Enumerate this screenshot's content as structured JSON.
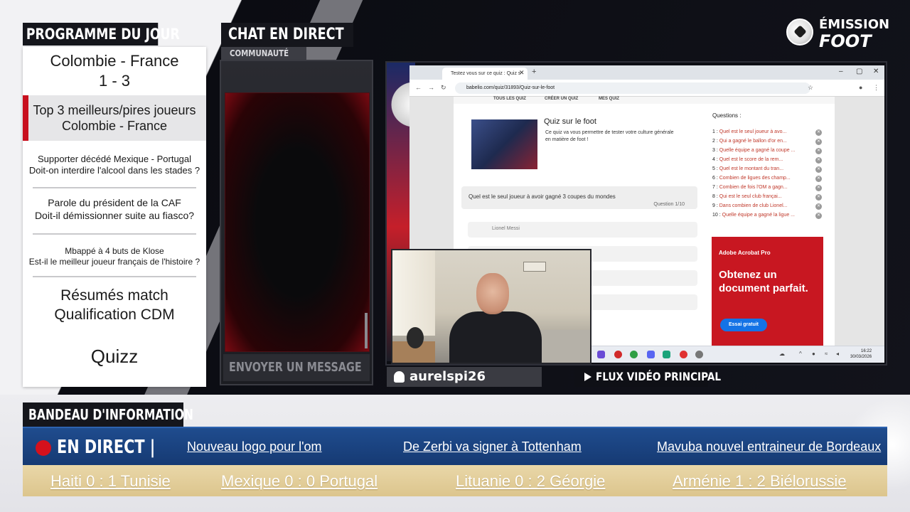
{
  "branding": {
    "line1": "ÉMISSION",
    "line2": "FOOT",
    "icon": "football-icon"
  },
  "programme": {
    "title": "PROGRAMME DU JOUR",
    "items": [
      {
        "line1": "Colombie - France",
        "line2": "1 - 3",
        "active": false
      },
      {
        "line1": "Top 3 meilleurs/pires joueurs",
        "line2": "Colombie - France",
        "active": true
      },
      {
        "line1": "Supporter décédé Mexique - Portugal",
        "line2": "Doit-on interdire l'alcool dans les stades ?",
        "active": false
      },
      {
        "line1": "Parole du président de la CAF",
        "line2": "Doit-il démissionner suite au fiasco?",
        "active": false
      },
      {
        "line1": "Mbappé à 4 buts de Klose",
        "line2": "Est-il le meilleur joueur français de l'histoire ?",
        "active": false
      },
      {
        "line1": "Résumés match",
        "line2": "Qualification CDM",
        "active": false
      },
      {
        "line1": "Quizz",
        "line2": "",
        "active": false
      }
    ]
  },
  "chat": {
    "title": "CHAT EN DIRECT",
    "subtitle": "COMMUNAUTÉ",
    "send_label": "ENVOYER UN MESSAGE"
  },
  "browser": {
    "tab_title": "Testez vous sur ce quiz : Quiz s",
    "url": "babelio.com/quiz/31893/Quiz-sur-le-foot",
    "site_nav": [
      "TOUS LES QUIZ",
      "CRÉER UN QUIZ",
      "MES QUIZ"
    ],
    "quiz_title": "Quiz sur le foot",
    "quiz_desc": "Ce quiz va vous permettre de tester votre culture générale en matière de foot !",
    "question": "Quel est le seul joueur à avoir gagné 3 coupes du mondes",
    "question_num": "Question 1/10",
    "answer1": "Lionel Messi",
    "questions_title": "Questions :",
    "questions": [
      {
        "num": "1 :",
        "text": "Quel est le seul joueur à avo..."
      },
      {
        "num": "2 :",
        "text": "Qui a gagné le ballon d'or en..."
      },
      {
        "num": "3 :",
        "text": "Quelle équipe a gagné la coupe ..."
      },
      {
        "num": "4 :",
        "text": "Quel est le score de la rem..."
      },
      {
        "num": "5 :",
        "text": "Quel est le montant du tran..."
      },
      {
        "num": "6 :",
        "text": "Combien de ligues des champ..."
      },
      {
        "num": "7 :",
        "text": "Combien de fois l'OM a gagn..."
      },
      {
        "num": "8 :",
        "text": "Qui est le seul club françai..."
      },
      {
        "num": "9 :",
        "text": "Dans combien de club Lionel..."
      },
      {
        "num": "10 :",
        "text": "Quelle équipe a gagné la ligue ..."
      }
    ],
    "ad": {
      "brand": "Adobe Acrobat Pro",
      "title": "Obtenez un document parfait.",
      "button": "Essai gratuit"
    },
    "clock_time": "16:22",
    "clock_date": "30/03/2026"
  },
  "streamer": {
    "name": "aurelspi26",
    "icon": "snapchat-ghost-icon"
  },
  "flux": {
    "label": "FLUX VIDÉO PRINCIPAL",
    "icon": "play-icon"
  },
  "bandeau": {
    "title": "BANDEAU D'INFORMATION",
    "live_label": "EN DIRECT |",
    "news": [
      "Nouveau logo pour l'om",
      "De Zerbi va signer à Tottenham",
      "Mavuba nouvel entraineur de Bordeaux"
    ],
    "scores": [
      "Haiti 0 : 1 Tunisie",
      "Mexique 0 : 0 Portugal",
      "Lituanie 0 : 2 Géorgie",
      "Arménie 1 : 2 Biélorussie"
    ]
  },
  "colors": {
    "header_dark": "#15161c",
    "accent_red": "#c8101e",
    "ticker_blue": "#1f4c8e",
    "scores_gold": "#dcc58d"
  }
}
